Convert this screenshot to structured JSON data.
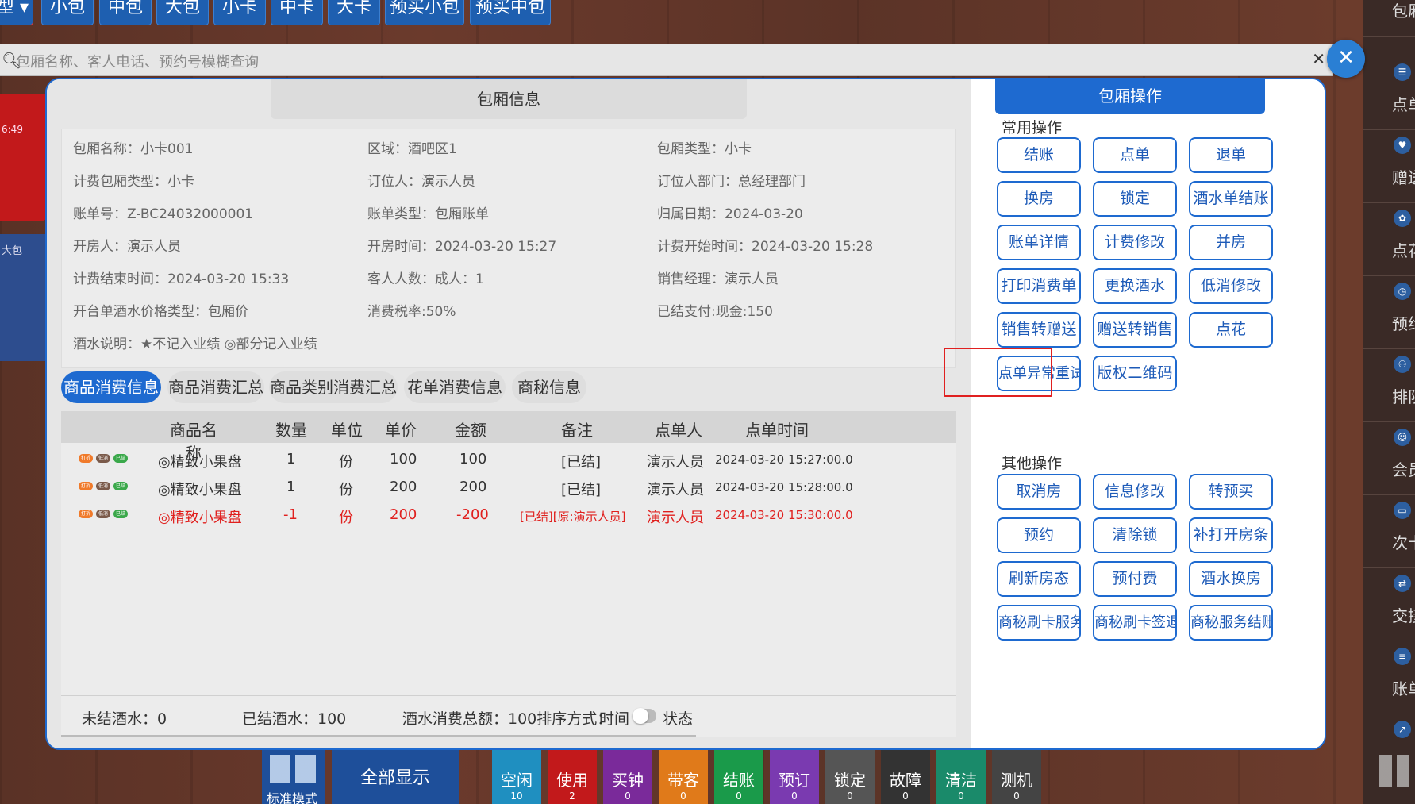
{
  "top_categories": [
    "型",
    "小包",
    "中包",
    "大包",
    "小卡",
    "中卡",
    "大卡",
    "预买小包",
    "预买中包"
  ],
  "search": {
    "placeholder": "包厢名称、客人电话、预约号模糊查询",
    "clear_icon": "close-icon"
  },
  "left_cards": {
    "red_time": "6:49",
    "blue_label": "大包"
  },
  "right_sidebar": [
    "包厢",
    "点单",
    "赠送",
    "点花",
    "预约",
    "排队",
    "会员",
    "次卡",
    "交接",
    "账单查"
  ],
  "bottom_bar": {
    "mode_label": "标准模式",
    "all_label": "全部显示",
    "statuses": [
      {
        "label": "空闲",
        "count": "10",
        "color": "#1f8fc0"
      },
      {
        "label": "使用",
        "count": "2",
        "color": "#c2191b"
      },
      {
        "label": "买钟",
        "count": "0",
        "color": "#7a2a9a"
      },
      {
        "label": "带客",
        "count": "0",
        "color": "#e07a1a"
      },
      {
        "label": "结账",
        "count": "0",
        "color": "#1a9a4a"
      },
      {
        "label": "预订",
        "count": "0",
        "color": "#7a3ab0"
      },
      {
        "label": "锁定",
        "count": "0",
        "color": "#555555"
      },
      {
        "label": "故障",
        "count": "0",
        "color": "#333333"
      },
      {
        "label": "清洁",
        "count": "0",
        "color": "#1a8a6a"
      },
      {
        "label": "测机",
        "count": "0",
        "color": "#444444"
      }
    ]
  },
  "modal": {
    "info_tab": "包厢信息",
    "info_rows": [
      [
        "包厢名称：小卡001",
        "区域：酒吧区1",
        "包厢类型：小卡"
      ],
      [
        "计费包厢类型：小卡",
        "订位人：演示人员",
        "订位人部门：总经理部门"
      ],
      [
        "账单号：Z-BC24032000001",
        "账单类型：包厢账单",
        "归属日期：2024-03-20"
      ],
      [
        "开房人：演示人员",
        "开房时间：2024-03-20 15:27",
        "计费开始时间：2024-03-20 15:28"
      ],
      [
        "计费结束时间：2024-03-20 15:33",
        "客人人数：成人：1",
        "销售经理：演示人员"
      ],
      [
        "开台单酒水价格类型：包厢价",
        "消费税率:50%",
        "已结支付:现金:150"
      ],
      [
        "酒水说明：★不记入业绩 ◎部分记入业绩",
        "",
        ""
      ]
    ],
    "tabs": [
      "商品消费信息",
      "商品消费汇总",
      "商品类别消费汇总",
      "花单消费信息",
      "商秘信息"
    ],
    "table_headers": [
      "商品名称",
      "数量",
      "单位",
      "单价",
      "金额",
      "备注",
      "点单人",
      "点单时间"
    ],
    "badges": [
      "打折",
      "低消",
      "已结"
    ],
    "rows": [
      {
        "name": "◎精致小果盘",
        "qty": "1",
        "unit": "份",
        "price": "100",
        "amount": "100",
        "note": "[已结]",
        "orderer": "演示人员",
        "time": "2024-03-20 15:27:00.0",
        "red": false
      },
      {
        "name": "◎精致小果盘",
        "qty": "1",
        "unit": "份",
        "price": "200",
        "amount": "200",
        "note": "[已结]",
        "orderer": "演示人员",
        "time": "2024-03-20 15:28:00.0",
        "red": false
      },
      {
        "name": "◎精致小果盘",
        "qty": "-1",
        "unit": "份",
        "price": "200",
        "amount": "-200",
        "note": "[已结][原:演示人员]",
        "orderer": "演示人员",
        "time": "2024-03-20 15:30:00.0",
        "red": true
      }
    ],
    "footer": {
      "unsettled": "未结酒水：0",
      "settled": "已结酒水：100",
      "total": "酒水消费总额：100排序方式：",
      "sort_time": "时间",
      "sort_status": "状态"
    },
    "ops_title": "包厢操作",
    "common_label": "常用操作",
    "common_ops": [
      "结账",
      "点单",
      "退单",
      "换房",
      "锁定",
      "酒水单结账",
      "账单详情",
      "计费修改",
      "并房",
      "打印消费单",
      "更换酒水",
      "低消修改",
      "销售转赠送",
      "赠送转销售",
      "点花",
      "点单异常重试",
      "版权二维码"
    ],
    "other_label": "其他操作",
    "other_ops": [
      "取消房",
      "信息修改",
      "转预买",
      "预约",
      "清除锁",
      "补打开房条",
      "刷新房态",
      "预付费",
      "酒水换房",
      "商秘刷卡服务",
      "商秘刷卡签退",
      "商秘服务结账"
    ]
  },
  "colors": {
    "accent": "#1e6ad0",
    "highlight": "#e02020",
    "negative": "#e0201e"
  }
}
